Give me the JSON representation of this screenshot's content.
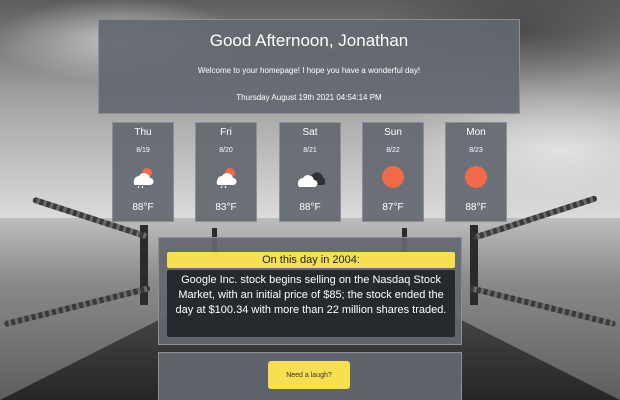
{
  "header": {
    "greeting": "Good Afternoon, Jonathan",
    "welcome": "Welcome to your homepage! I hope you have a wonderful day!",
    "datetime": "Thursday August 19th 2021 04:54:14 PM"
  },
  "forecast": [
    {
      "day": "Thu",
      "date": "8/19",
      "icon": "cloud-sun-rain-icon",
      "temp": "88°F"
    },
    {
      "day": "Fri",
      "date": "8/20",
      "icon": "cloud-sun-rain-icon",
      "temp": "83°F"
    },
    {
      "day": "Sat",
      "date": "8/21",
      "icon": "cloudy-icon",
      "temp": "88°F"
    },
    {
      "day": "Sun",
      "date": "8/22",
      "icon": "sun-icon",
      "temp": "87°F"
    },
    {
      "day": "Mon",
      "date": "8/23",
      "icon": "sun-icon",
      "temp": "88°F"
    }
  ],
  "history": {
    "title": "On this day in 2004:",
    "body": "Google Inc. stock begins selling on the Nasdaq Stock Market, with an initial price of $85; the stock ended the day at $100.34 with more than 22 million shares traded."
  },
  "laugh": {
    "button_label": "Need a laugh?"
  },
  "colors": {
    "accent": "#f7df52",
    "panel": "#636870",
    "sun": "#f06a4a"
  }
}
